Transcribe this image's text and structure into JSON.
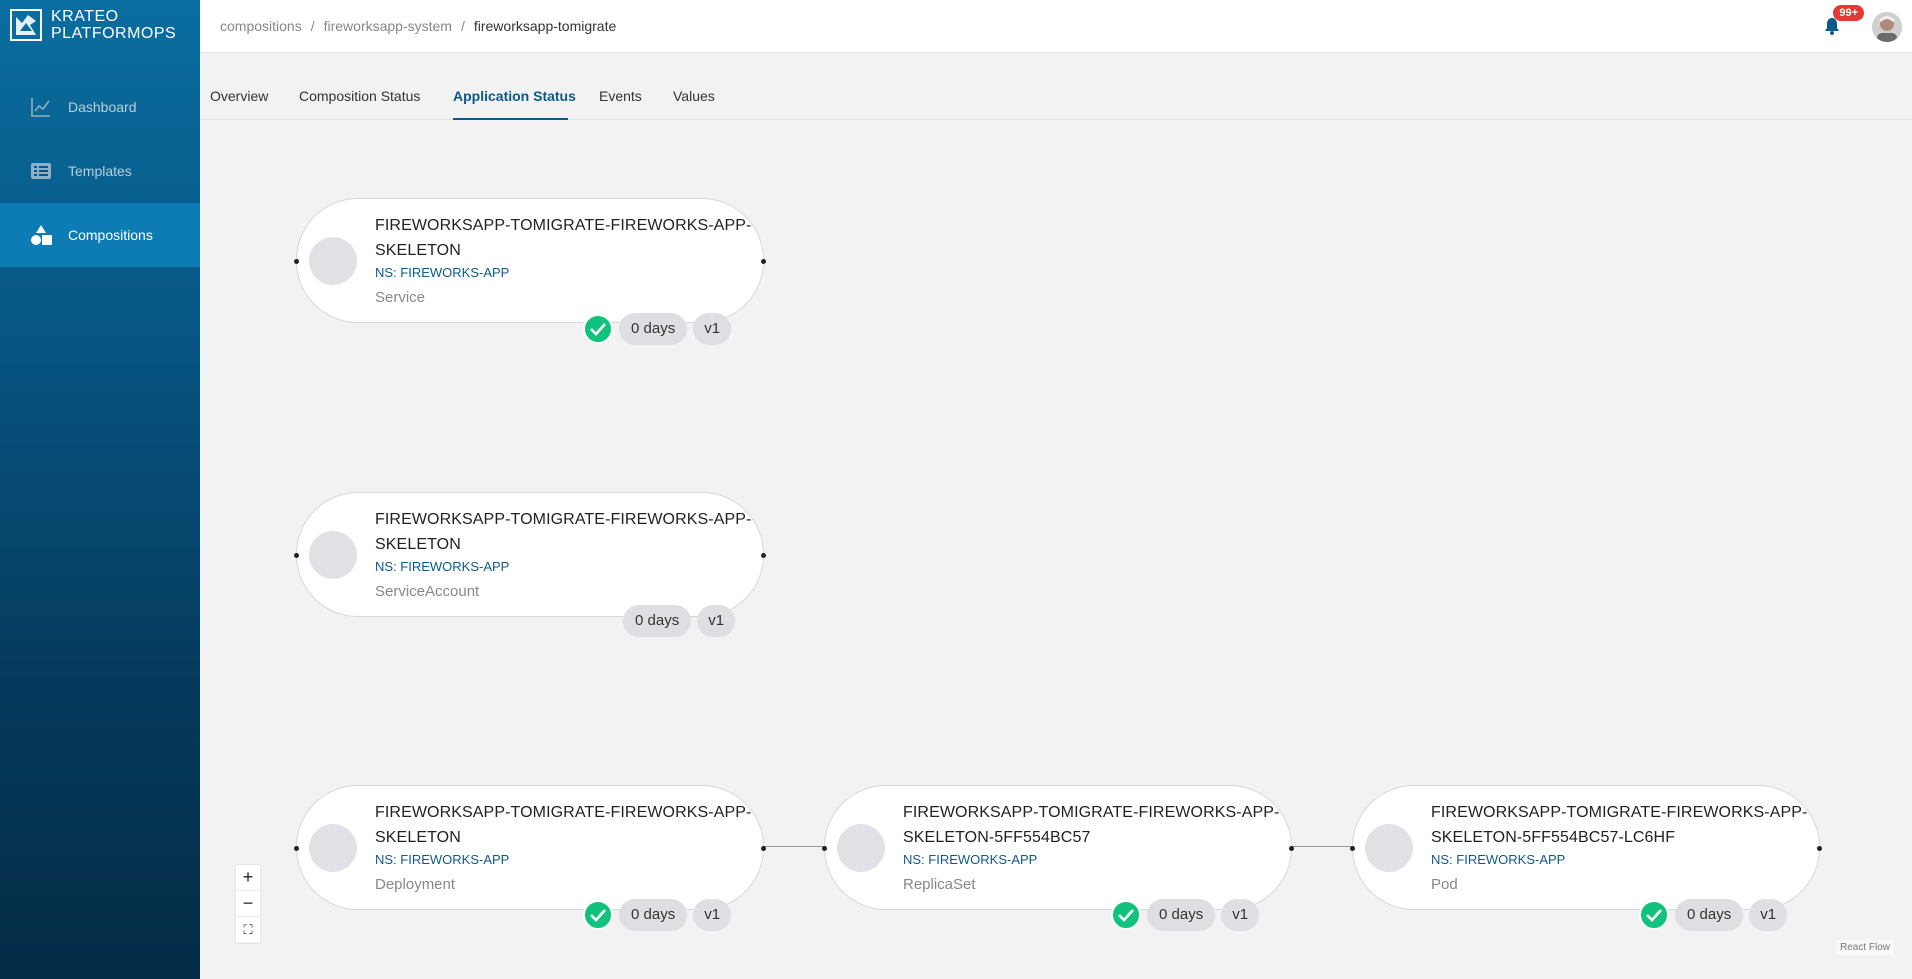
{
  "brand": {
    "line1": "KRATEO",
    "line2": "PLATFORMOPS"
  },
  "sidebar": {
    "items": [
      {
        "label": "Dashboard",
        "icon": "chart-line-icon"
      },
      {
        "label": "Templates",
        "icon": "list-icon"
      },
      {
        "label": "Compositions",
        "icon": "shapes-icon",
        "active": true
      }
    ]
  },
  "breadcrumb": [
    "compositions",
    "fireworksapp-system",
    "fireworksapp-tomigrate"
  ],
  "header": {
    "notification_count": "99+"
  },
  "tabs": [
    "Overview",
    "Composition Status",
    "Application Status",
    "Events",
    "Values"
  ],
  "active_tab": "Application Status",
  "nodes": [
    {
      "title": "FIREWORKSAPP-TOMIGRATE-FIREWORKS-APP-SKELETON",
      "ns": "NS: FIREWORKS-APP",
      "kind": "Service",
      "healthy": true,
      "age": "0 days",
      "version": "v1"
    },
    {
      "title": "FIREWORKSAPP-TOMIGRATE-FIREWORKS-APP-SKELETON",
      "ns": "NS: FIREWORKS-APP",
      "kind": "ServiceAccount",
      "healthy": false,
      "age": "0 days",
      "version": "v1"
    },
    {
      "title": "FIREWORKSAPP-TOMIGRATE-FIREWORKS-APP-SKELETON",
      "ns": "NS: FIREWORKS-APP",
      "kind": "Deployment",
      "healthy": true,
      "age": "0 days",
      "version": "v1"
    },
    {
      "title": "FIREWORKSAPP-TOMIGRATE-FIREWORKS-APP-SKELETON-5FF554BC57",
      "ns": "NS: FIREWORKS-APP",
      "kind": "ReplicaSet",
      "healthy": true,
      "age": "0 days",
      "version": "v1"
    },
    {
      "title": "FIREWORKSAPP-TOMIGRATE-FIREWORKS-APP-SKELETON-5FF554BC57-LC6HF",
      "ns": "NS: FIREWORKS-APP",
      "kind": "Pod",
      "healthy": true,
      "age": "0 days",
      "version": "v1"
    }
  ],
  "controls": {
    "zoom_in": "+",
    "zoom_out": "−",
    "fit": "⛶"
  },
  "attribution": "React Flow",
  "colors": {
    "accent": "#0d5a8a",
    "healthy": "#10c27b",
    "badge": "#e53935"
  }
}
